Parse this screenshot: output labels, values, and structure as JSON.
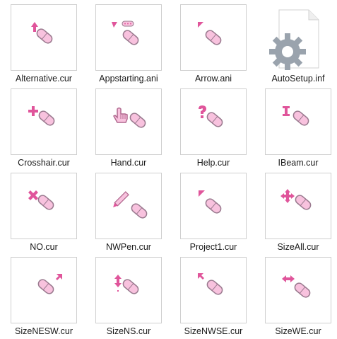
{
  "files": [
    {
      "name": "Alternative.cur",
      "icon": "up-arrow-cursor-icon"
    },
    {
      "name": "Appstarting.ani",
      "icon": "busy-cursor-icon"
    },
    {
      "name": "Arrow.ani",
      "icon": "arrow-cursor-icon"
    },
    {
      "name": "AutoSetup.inf",
      "icon": "settings-file-icon"
    },
    {
      "name": "Crosshair.cur",
      "icon": "crosshair-cursor-icon"
    },
    {
      "name": "Hand.cur",
      "icon": "hand-cursor-icon"
    },
    {
      "name": "Help.cur",
      "icon": "help-cursor-icon"
    },
    {
      "name": "IBeam.cur",
      "icon": "ibeam-cursor-icon"
    },
    {
      "name": "NO.cur",
      "icon": "no-cursor-icon"
    },
    {
      "name": "NWPen.cur",
      "icon": "pen-cursor-icon"
    },
    {
      "name": "Project1.cur",
      "icon": "arrow-cursor-icon"
    },
    {
      "name": "SizeAll.cur",
      "icon": "move-cursor-icon"
    },
    {
      "name": "SizeNESW.cur",
      "icon": "resize-nesw-cursor-icon"
    },
    {
      "name": "SizeNS.cur",
      "icon": "resize-ns-cursor-icon"
    },
    {
      "name": "SizeNWSE.cur",
      "icon": "resize-nwse-cursor-icon"
    },
    {
      "name": "SizeWE.cur",
      "icon": "resize-we-cursor-icon"
    }
  ],
  "colors": {
    "pink": "#e0559b",
    "pill_fill": "#f8c2de",
    "pill_outline": "#9a7a8f",
    "gear": "#9aa3ad"
  }
}
